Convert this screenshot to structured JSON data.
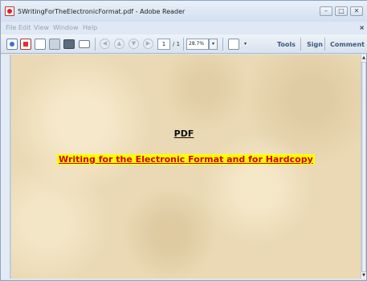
{
  "window": {
    "title": "5WritingForTheElectronicFormat.pdf - Adobe Reader",
    "controls": {
      "minimize": "–",
      "maximize": "□",
      "close": "✕"
    }
  },
  "menu": {
    "items": [
      "File",
      "Edit",
      "View",
      "Window",
      "Help"
    ],
    "close_glyph": "×"
  },
  "toolbar": {
    "page_current": "1",
    "page_total": "/ 1",
    "zoom": "28.7%",
    "dropdown_glyph": "▾",
    "right_buttons": [
      "Tools",
      "Sign",
      "Comment"
    ]
  },
  "document": {
    "heading": "PDF",
    "subtitle": "Writing for the Electronic Format and for Hardcopy"
  },
  "scrollbar": {
    "up_glyph": "▲",
    "down_glyph": "▼"
  },
  "colors": {
    "paper": "#ead9b4",
    "highlight": "#ffff00",
    "subtitle_text": "#d60000",
    "toolbar_text": "#3c5a83"
  }
}
